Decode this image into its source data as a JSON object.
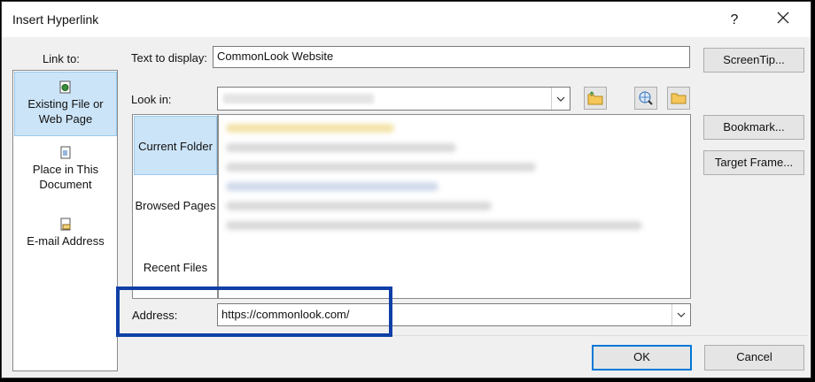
{
  "dialog": {
    "title": "Insert Hyperlink",
    "help_glyph": "?"
  },
  "link_to": {
    "label": "Link to:",
    "items": [
      {
        "line1": "Existing File or",
        "line2": "Web Page",
        "icon": "existing-file-icon"
      },
      {
        "line1": "Place in This",
        "line2": "Document",
        "icon": "place-in-document-icon"
      },
      {
        "line1": "E-mail Address",
        "icon": "email-address-icon"
      }
    ]
  },
  "text_to_display": {
    "label": "Text to display:",
    "value": "CommonLook Website"
  },
  "screentip_label": "ScreenTip...",
  "look_in": {
    "label": "Look in:",
    "value": ""
  },
  "browse_tabs": [
    "Current Folder",
    "Browsed Pages",
    "Recent Files"
  ],
  "right_buttons": {
    "bookmark": "Bookmark...",
    "target_frame": "Target Frame..."
  },
  "address": {
    "label": "Address:",
    "value": "https://commonlook.com/"
  },
  "footer": {
    "ok": "OK",
    "cancel": "Cancel"
  },
  "colors": {
    "selected_bg": "#cce4f7",
    "highlight_border": "#0f3fa6",
    "default_button_border": "#0078d7"
  }
}
